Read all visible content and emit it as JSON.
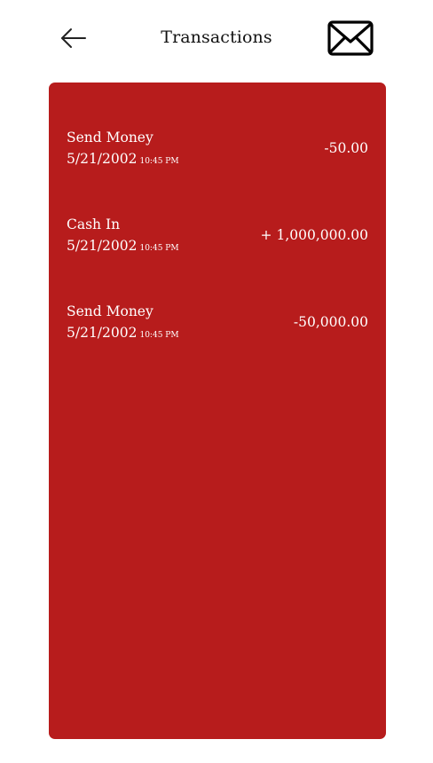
{
  "header": {
    "title": "Transactions",
    "back_icon": "arrow-left-icon",
    "mail_icon": "envelope-icon"
  },
  "colors": {
    "card_background": "#b71c1c",
    "card_text": "#ffffff",
    "page_background": "#ffffff"
  },
  "transactions": [
    {
      "type": "Send Money",
      "date": "5/21/2002",
      "time": "10:45 PM",
      "amount": "-50.00"
    },
    {
      "type": "Cash In",
      "date": "5/21/2002",
      "time": "10:45 PM",
      "amount": "+ 1,000,000.00"
    },
    {
      "type": "Send Money",
      "date": "5/21/2002",
      "time": "10:45 PM",
      "amount": "-50,000.00"
    }
  ]
}
